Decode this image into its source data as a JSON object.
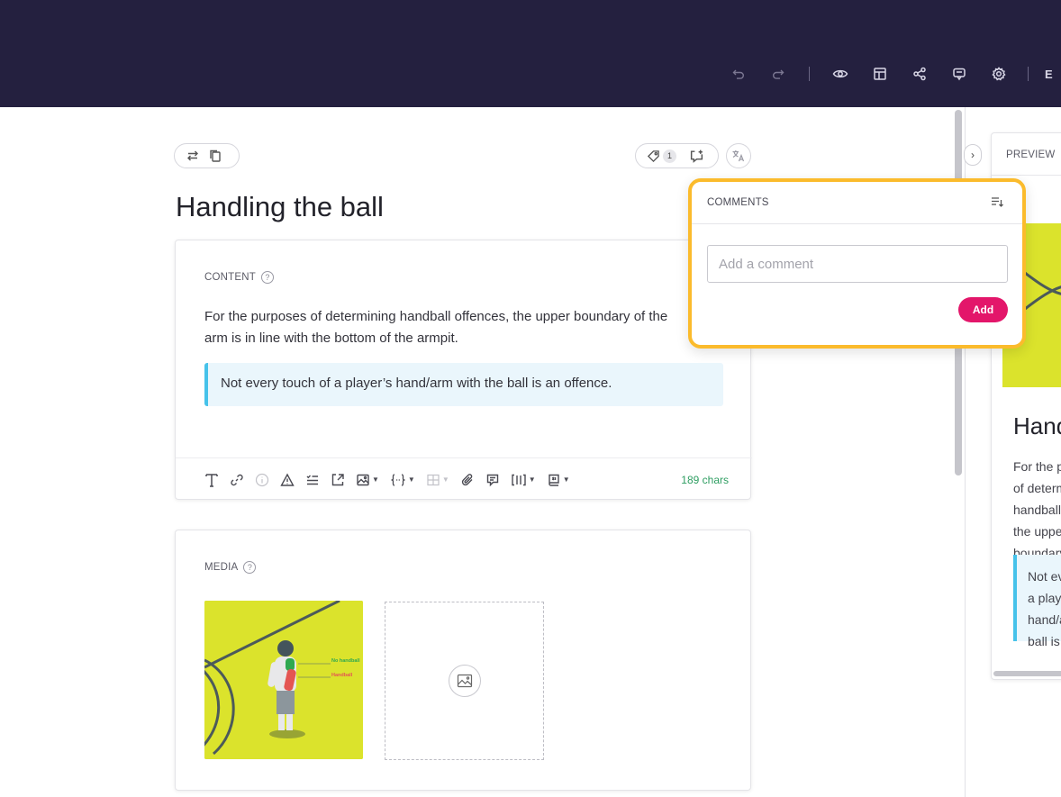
{
  "toolbar": {
    "icons": [
      "undo-icon",
      "redo-icon",
      "eye-icon",
      "layout-icon",
      "share-icon",
      "comments-icon",
      "gear-icon"
    ],
    "cut_text": "E"
  },
  "entry": {
    "title": "Handling the ball",
    "tag_count": "1",
    "content": {
      "label": "CONTENT",
      "paragraph_line1": "For the purposes of determining handball offences, the upper boundary of the",
      "paragraph_line2": "arm is in line with the bottom of the armpit.",
      "callout": "Not every touch of a player’s hand/arm with the ball is an offence.",
      "char_count": "189 chars"
    },
    "media": {
      "label": "MEDIA",
      "image_labels": [
        "No handball",
        "Handball"
      ]
    }
  },
  "preview": {
    "label": "PREVIEW",
    "title": "Handling the ball",
    "text": "For the purposes of determining handball offences, the upper boundary of the arm is in line with the bottom of the armpit.",
    "callout": "Not every touch of a player’s hand/arm with the ball is an offence."
  },
  "comments": {
    "title": "COMMENTS",
    "placeholder": "Add a comment",
    "add_label": "Add"
  },
  "colors": {
    "topbar": "#24203f",
    "accent": "#e3166a",
    "highlight": "#fbbb2c",
    "callout_border": "#46c2ea",
    "media_bg": "#dbe32c",
    "char_count": "#2f9e62"
  }
}
